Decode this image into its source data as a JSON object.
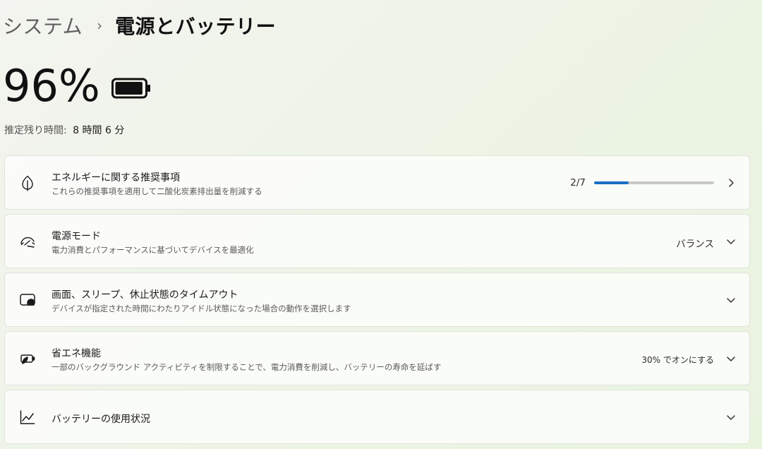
{
  "breadcrumb": {
    "parent": "システム",
    "separator": "›",
    "current": "電源とバッテリー"
  },
  "battery": {
    "level": "96%",
    "level_value": 0.96,
    "remaining_label": "推定残り時間:",
    "remaining_value": "8 時間 6 分"
  },
  "cards": [
    {
      "icon": "leaf-icon",
      "title": "エネルギーに関する推奨事項",
      "subtitle": "これらの推奨事項を適用して二酸化炭素排出量を削減する",
      "progress_text": "2/7",
      "progress_value": 0.2857,
      "trailing": "chevron-right-icon"
    },
    {
      "icon": "speedometer-icon",
      "title": "電源モード",
      "subtitle": "電力消費とパフォーマンスに基づいてデバイスを最適化",
      "value": "バランス",
      "trailing": "chevron-down-icon"
    },
    {
      "icon": "sleep-timeout-icon",
      "title": "画面、スリープ、休止状態のタイムアウト",
      "subtitle": "デバイスが指定された時間にわたりアイドル状態になった場合の動作を選択します",
      "trailing": "chevron-down-icon"
    },
    {
      "icon": "battery-saver-icon",
      "title": "省エネ機能",
      "subtitle": "一部のバックグラウンド アクティビティを制限することで、電力消費を削減し、バッテリーの寿命を延ばす",
      "value": "30% でオンにする",
      "trailing": "chevron-down-icon"
    },
    {
      "icon": "line-chart-icon",
      "title": "バッテリーの使用状況",
      "trailing": "chevron-down-icon"
    }
  ],
  "colors": {
    "accent": "#1a6fc4",
    "progress_track": "#c9c9c9"
  }
}
